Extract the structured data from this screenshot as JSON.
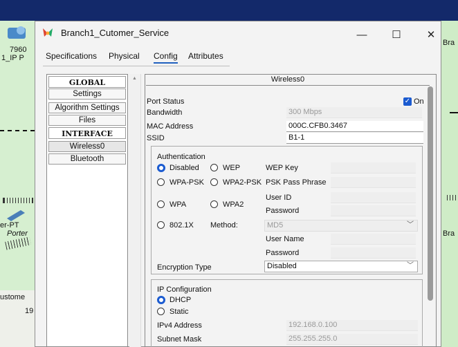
{
  "background": {
    "left_icon_label_1": "7960",
    "left_icon_label_2": "1_IP P",
    "left_label_er": "er-PT",
    "left_label_porter": "Porter",
    "left_label_customer": "ustome",
    "left_label_19": "19",
    "right_label_1": "Bra",
    "right_label_2": "Bra"
  },
  "window": {
    "title": "Branch1_Cutomer_Service",
    "minimize": "—",
    "maximize": "☐",
    "close": "✕"
  },
  "tabs": [
    "Specifications",
    "Physical",
    "Config",
    "Attributes"
  ],
  "active_tab": "Config",
  "nav": {
    "global_header": "GLOBAL",
    "settings": "Settings",
    "algorithm": "Algorithm Settings",
    "files": "Files",
    "interface_header": "INTERFACE",
    "wireless0": "Wireless0",
    "bluetooth": "Bluetooth"
  },
  "pane": {
    "title": "Wireless0",
    "port_status_label": "Port Status",
    "port_status_value": "On",
    "bandwidth_label": "Bandwidth",
    "bandwidth_value": "300 Mbps",
    "mac_label": "MAC Address",
    "mac_value": "000C.CFB0.3467",
    "ssid_label": "SSID",
    "ssid_value": "B1-1"
  },
  "auth": {
    "title": "Authentication",
    "disabled": "Disabled",
    "wep": "WEP",
    "wep_key": "WEP Key",
    "wpa_psk": "WPA-PSK",
    "wpa2_psk": "WPA2-PSK",
    "psk_pass": "PSK Pass Phrase",
    "wpa": "WPA",
    "wpa2": "WPA2",
    "user_id": "User ID",
    "password": "Password",
    "dot1x": "802.1X",
    "method_label": "Method:",
    "method_value": "MD5",
    "user_name": "User Name",
    "password2": "Password",
    "encryption_label": "Encryption Type",
    "encryption_value": "Disabled"
  },
  "ip": {
    "title": "IP Configuration",
    "dhcp": "DHCP",
    "static": "Static",
    "ipv4_label": "IPv4 Address",
    "ipv4_value": "192.168.0.100",
    "mask_label": "Subnet Mask",
    "mask_value": "255.255.255.0"
  },
  "colors": {
    "accent": "#1b5bd0",
    "titlebar_bg": "#13296a"
  }
}
